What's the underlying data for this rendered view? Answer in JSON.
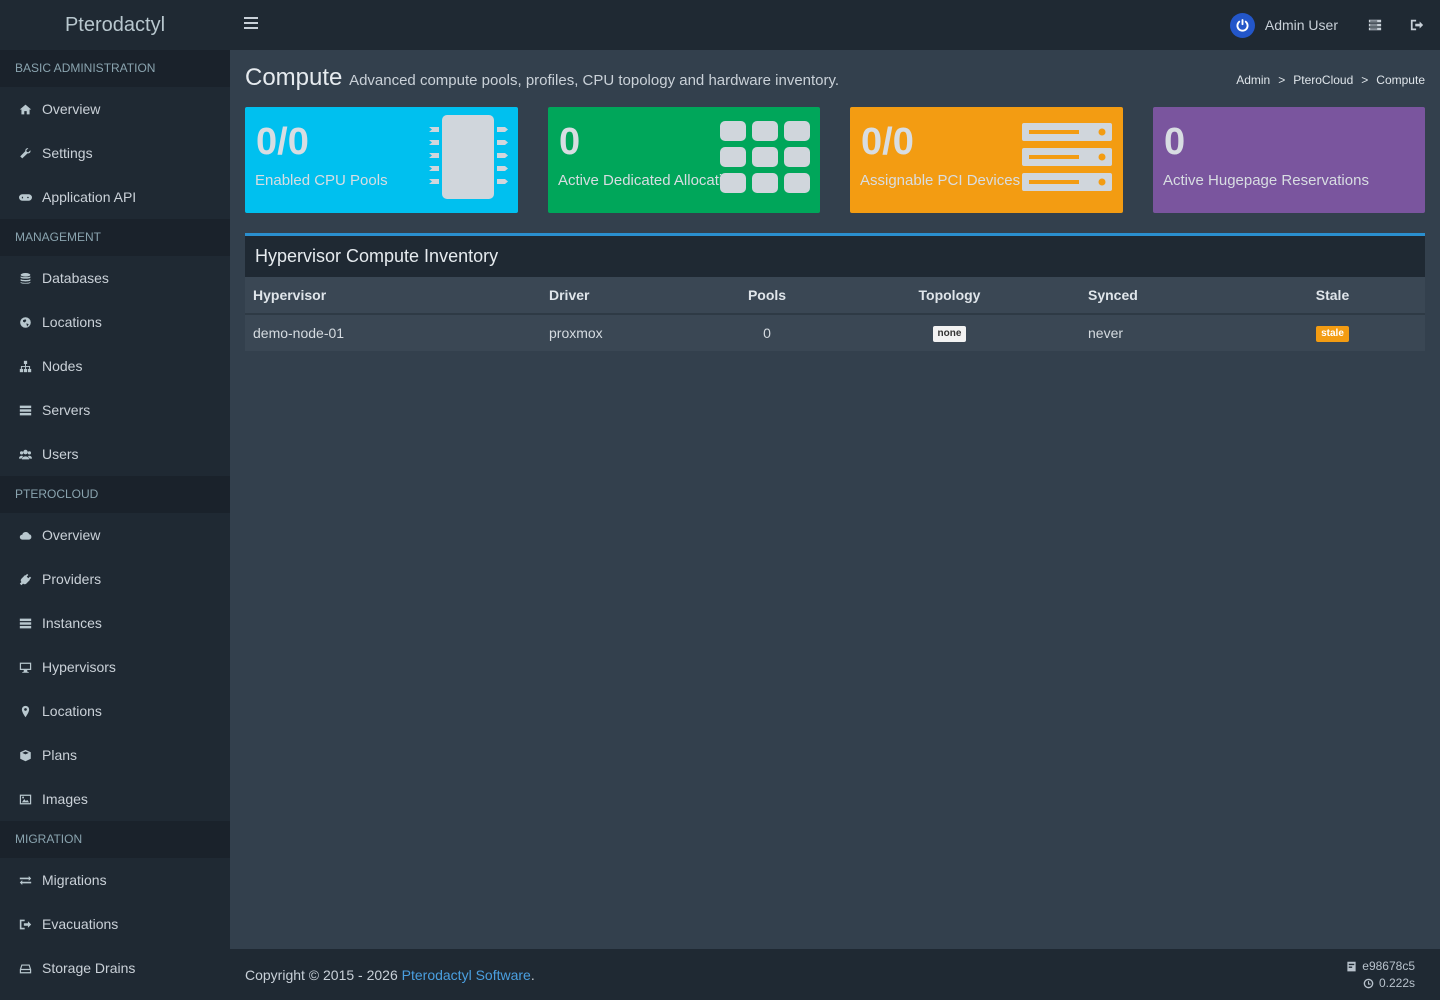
{
  "brand": "Pterodactyl",
  "sidebar": {
    "sections": [
      {
        "header": "BASIC ADMINISTRATION",
        "items": [
          {
            "label": "Overview",
            "icon": "home-icon"
          },
          {
            "label": "Settings",
            "icon": "wrench-icon"
          },
          {
            "label": "Application API",
            "icon": "gamepad-icon"
          }
        ]
      },
      {
        "header": "MANAGEMENT",
        "items": [
          {
            "label": "Databases",
            "icon": "database-icon"
          },
          {
            "label": "Locations",
            "icon": "globe-icon"
          },
          {
            "label": "Nodes",
            "icon": "sitemap-icon"
          },
          {
            "label": "Servers",
            "icon": "server-icon"
          },
          {
            "label": "Users",
            "icon": "users-icon"
          }
        ]
      },
      {
        "header": "PTEROCLOUD",
        "items": [
          {
            "label": "Overview",
            "icon": "cloud-icon"
          },
          {
            "label": "Providers",
            "icon": "plug-icon"
          },
          {
            "label": "Instances",
            "icon": "server-icon"
          },
          {
            "label": "Hypervisors",
            "icon": "desktop-icon"
          },
          {
            "label": "Locations",
            "icon": "map-marker-icon"
          },
          {
            "label": "Plans",
            "icon": "cube-icon"
          },
          {
            "label": "Images",
            "icon": "image-icon"
          }
        ]
      },
      {
        "header": "MIGRATION",
        "items": [
          {
            "label": "Migrations",
            "icon": "exchange-icon"
          },
          {
            "label": "Evacuations",
            "icon": "sign-out-icon"
          },
          {
            "label": "Storage Drains",
            "icon": "hdd-icon"
          }
        ]
      }
    ]
  },
  "topbar": {
    "user_name": "Admin User",
    "icons": [
      "hamburger-icon",
      "power-icon",
      "server-icon",
      "sign-out-icon"
    ]
  },
  "page": {
    "title": "Compute",
    "subtitle": "Advanced compute pools, profiles, CPU topology and hardware inventory.",
    "breadcrumb": [
      "Admin",
      "PteroCloud",
      "Compute"
    ]
  },
  "stats": [
    {
      "value": "0/0",
      "label": "Enabled CPU Pools",
      "color": "#00c0ef",
      "icon": "microchip-icon"
    },
    {
      "value": "0",
      "label": "Active Dedicated Allocations",
      "color": "#00a65a",
      "icon": "grid-icon"
    },
    {
      "value": "0/0",
      "label": "Assignable PCI Devices",
      "color": "#f39c12",
      "icon": "server-rack-icon"
    },
    {
      "value": "0",
      "label": "Active Hugepage Reservations",
      "color": "#7a559e",
      "icon": ""
    }
  ],
  "inventory": {
    "title": "Hypervisor Compute Inventory",
    "columns": [
      "Hypervisor",
      "Driver",
      "Pools",
      "Topology",
      "Synced",
      "Stale"
    ],
    "rows": [
      {
        "hypervisor": "demo-node-01",
        "driver": "proxmox",
        "pools": "0",
        "topology": "none",
        "synced": "never",
        "stale": "stale"
      }
    ]
  },
  "footer": {
    "copyright": "Copyright © 2015 - 2026 ",
    "link": "Pterodactyl Software",
    "period": ".",
    "version": "e98678c5",
    "time": "0.222s"
  }
}
